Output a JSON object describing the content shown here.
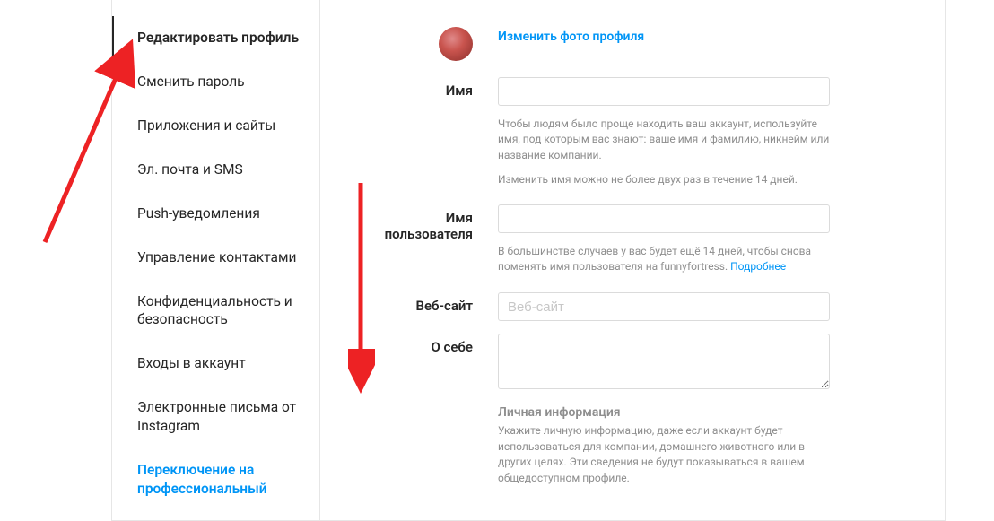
{
  "sidebar": {
    "items": [
      {
        "label": "Редактировать профиль"
      },
      {
        "label": "Сменить пароль"
      },
      {
        "label": "Приложения и сайты"
      },
      {
        "label": "Эл. почта и SMS"
      },
      {
        "label": "Push-уведомления"
      },
      {
        "label": "Управление контактами"
      },
      {
        "label": "Конфиденциальность и безопасность"
      },
      {
        "label": "Входы в аккаунт"
      },
      {
        "label": "Электронные письма от Instagram"
      },
      {
        "label": "Переключение на профессиональный"
      }
    ]
  },
  "form": {
    "change_photo": "Изменить фото профиля",
    "name_label": "Имя",
    "name_help1": "Чтобы людям было проще находить ваш аккаунт, используйте имя, под которым вас знают: ваше имя и фамилию, никнейм или название компании.",
    "name_help2": "Изменить имя можно не более двух раз в течение 14 дней.",
    "username_label": "Имя пользователя",
    "username_help_prefix": "В большинстве случаев у вас будет ещё 14 дней, чтобы снова поменять имя пользователя на funnyfortress. ",
    "username_help_link": "Подробнее",
    "website_label": "Веб-сайт",
    "website_placeholder": "Веб-сайт",
    "bio_label": "О себе",
    "personal_title": "Личная информация",
    "personal_help": "Укажите личную информацию, даже если аккаунт будет использоваться для компании, домашнего животного или в других целях. Эти сведения не будут показываться в вашем общедоступном профиле."
  }
}
